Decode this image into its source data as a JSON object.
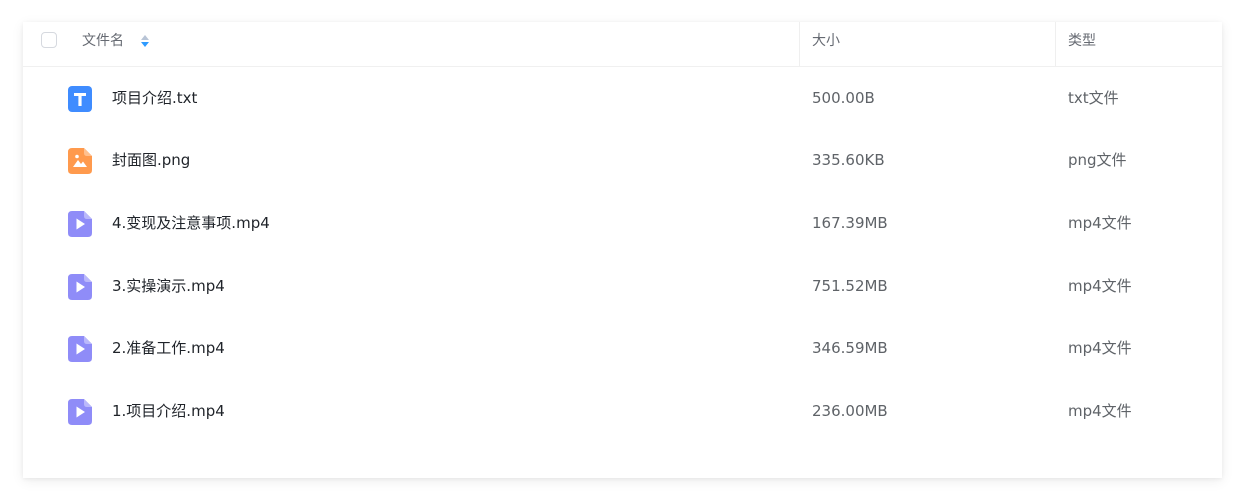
{
  "columns": {
    "name": "文件名",
    "size": "大小",
    "type": "类型"
  },
  "colors": {
    "txt": "#3f8cff",
    "image": "#ff9a4d",
    "video": "#8f8cf8",
    "sort_active": "#2f9bff",
    "sort_inactive": "#b8c4d6"
  },
  "files": [
    {
      "name": "项目介绍.txt",
      "size": "500.00B",
      "type": "txt文件",
      "icon": "text-file-icon"
    },
    {
      "name": "封面图.png",
      "size": "335.60KB",
      "type": "png文件",
      "icon": "image-file-icon"
    },
    {
      "name": "4.变现及注意事项.mp4",
      "size": "167.39MB",
      "type": "mp4文件",
      "icon": "video-file-icon"
    },
    {
      "name": "3.实操演示.mp4",
      "size": "751.52MB",
      "type": "mp4文件",
      "icon": "video-file-icon"
    },
    {
      "name": "2.准备工作.mp4",
      "size": "346.59MB",
      "type": "mp4文件",
      "icon": "video-file-icon"
    },
    {
      "name": "1.项目介绍.mp4",
      "size": "236.00MB",
      "type": "mp4文件",
      "icon": "video-file-icon"
    }
  ]
}
